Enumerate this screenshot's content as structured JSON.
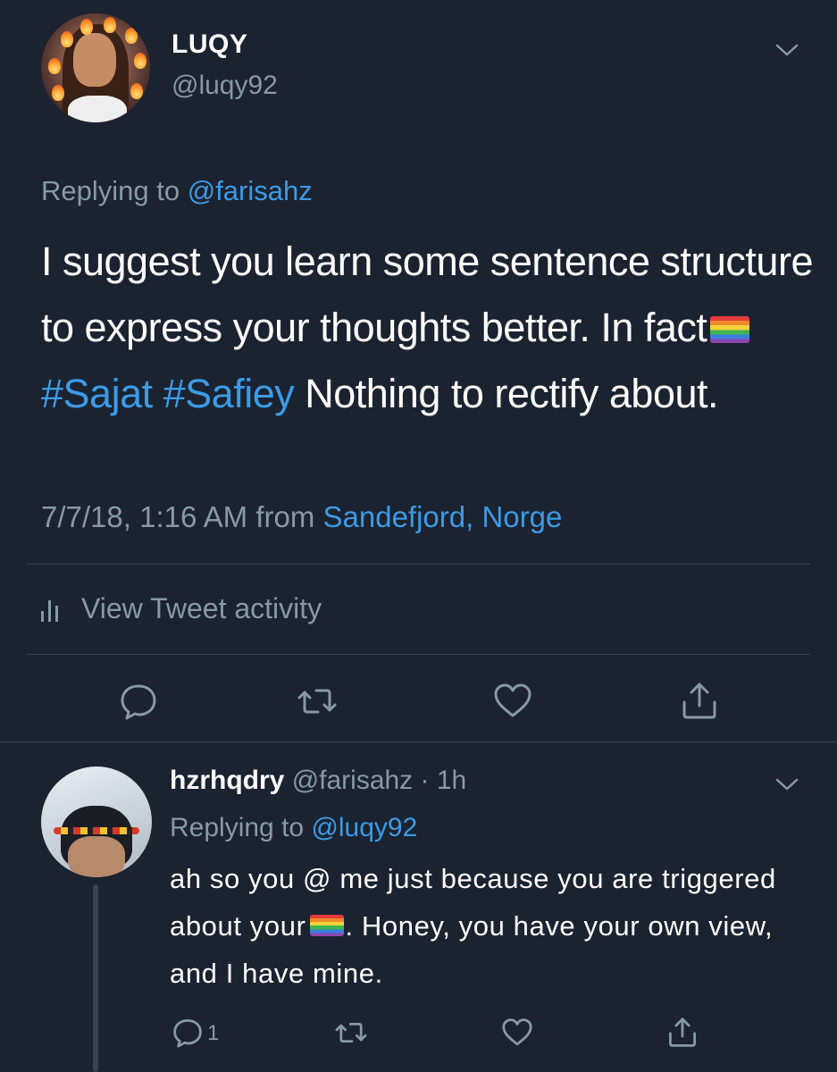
{
  "main_tweet": {
    "display_name": "LUQY",
    "handle": "@luqy92",
    "replying_prefix": "Replying to ",
    "replying_to": "@farisahz",
    "text_part1": "I suggest you learn some sentence structure to express your thoughts better. In fact",
    "flag_icon": "rainbow-flag",
    "hashtag1": "#Sajat",
    "hashtag2": "#Safiey",
    "text_part2": " Nothing to rectify about.",
    "timestamp": "7/7/18, 1:16 AM from ",
    "location": "Sandefjord, Norge",
    "activity_label": "View Tweet activity",
    "actions": [
      "reply-icon",
      "retweet-icon",
      "like-icon",
      "share-icon"
    ]
  },
  "reply_tweet": {
    "display_name": "hzrhqdry",
    "handle": "@farisahz",
    "separator": " · ",
    "time": "1h",
    "replying_prefix": "Replying to ",
    "replying_to": "@luqy92",
    "text_part1": "ah so you @ me just because you are triggered about your",
    "flag_icon": "rainbow-flag",
    "text_part2": ". Honey, you have your own view, and I have mine.",
    "reply_count": "1",
    "actions": [
      "reply-icon",
      "retweet-icon",
      "like-icon",
      "share-icon"
    ]
  },
  "colors": {
    "background": "#1b2330",
    "link": "#3b9be6",
    "secondary_text": "#8899a6",
    "divider": "#38444d"
  }
}
